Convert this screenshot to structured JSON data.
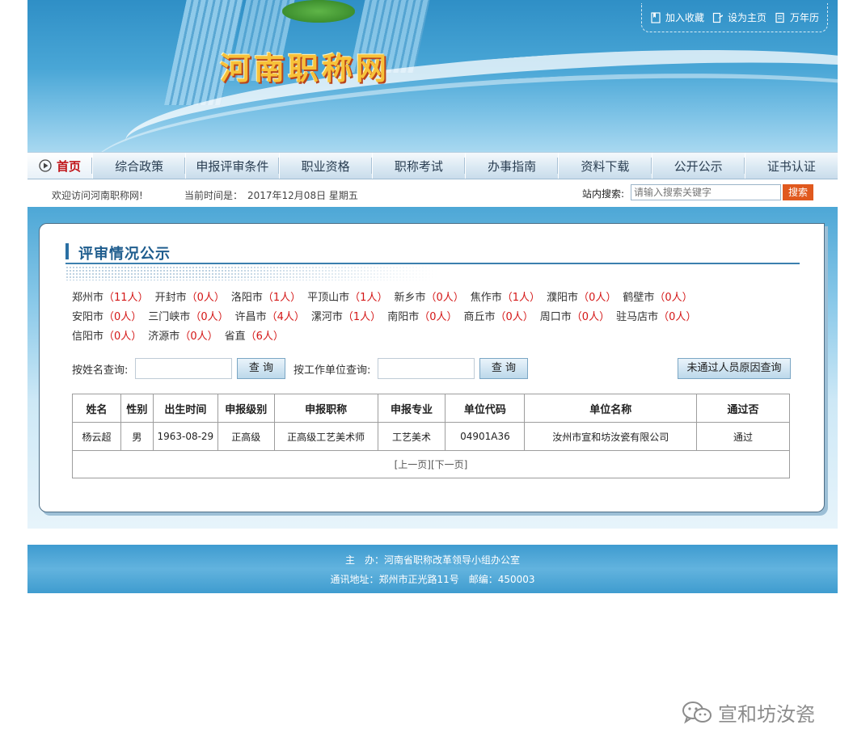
{
  "header": {
    "site_title": "河南职称网",
    "toplinks": [
      {
        "label": "加入收藏",
        "icon": "bookmark-icon"
      },
      {
        "label": "设为主页",
        "icon": "home-page-icon"
      },
      {
        "label": "万年历",
        "icon": "calendar-icon"
      }
    ]
  },
  "nav": {
    "home": "首页",
    "items": [
      "综合政策",
      "申报评审条件",
      "职业资格",
      "职称考试",
      "办事指南",
      "资料下载",
      "公开公示",
      "证书认证"
    ]
  },
  "infobar": {
    "welcome": "欢迎访问河南职称网!",
    "time_label": "当前时间是：",
    "time_value": "2017年12月08日 星期五",
    "search_label": "站内搜索:",
    "search_placeholder": "请输入搜索关键字",
    "search_button": "搜索"
  },
  "section": {
    "title": "评审情况公示",
    "cities": [
      {
        "name": "郑州市",
        "count": "（11人）"
      },
      {
        "name": "开封市",
        "count": "（0人）"
      },
      {
        "name": "洛阳市",
        "count": "（1人）"
      },
      {
        "name": "平顶山市",
        "count": "（1人）"
      },
      {
        "name": "新乡市",
        "count": "（0人）"
      },
      {
        "name": "焦作市",
        "count": "（1人）"
      },
      {
        "name": "濮阳市",
        "count": "（0人）"
      },
      {
        "name": "鹤壁市",
        "count": "（0人）"
      },
      {
        "name": "安阳市",
        "count": "（0人）"
      },
      {
        "name": "三门峡市",
        "count": "（0人）"
      },
      {
        "name": "许昌市",
        "count": "（4人）"
      },
      {
        "name": "漯河市",
        "count": "（1人）"
      },
      {
        "name": "南阳市",
        "count": "（0人）"
      },
      {
        "name": "商丘市",
        "count": "（0人）"
      },
      {
        "name": "周口市",
        "count": "（0人）"
      },
      {
        "name": "驻马店市",
        "count": "（0人）"
      },
      {
        "name": "信阳市",
        "count": "（0人）"
      },
      {
        "name": "济源市",
        "count": "（0人）"
      },
      {
        "name": "省直",
        "count": "（6人）"
      }
    ],
    "query": {
      "name_label": "按姓名查询:",
      "name_value": "",
      "name_button": "查 询",
      "unit_label": "按工作单位查询:",
      "unit_value": "",
      "unit_button": "查 询",
      "fail_button": "未通过人员原因查询"
    },
    "table": {
      "headers": [
        "姓名",
        "性别",
        "出生时间",
        "申报级别",
        "申报职称",
        "申报专业",
        "单位代码",
        "单位名称",
        "通过否"
      ],
      "rows": [
        [
          "杨云超",
          "男",
          "1963-08-29",
          "正高级",
          "正高级工艺美术师",
          "工艺美术",
          "04901A36",
          "汝州市宣和坊汝瓷有限公司",
          "通过"
        ]
      ],
      "pager_prev": "[上一页]",
      "pager_next": "[下一页]"
    }
  },
  "footer": {
    "line1": "主　办：河南省职称改革领导小组办公室",
    "line2": "通讯地址：郑州市正光路11号　邮编：450003"
  },
  "watermark": {
    "text": "宣和坊汝瓷",
    "icon": "wechat-icon"
  },
  "colors": {
    "nav_home": "#c0161a",
    "count_red": "#d41717",
    "search_button": "#e0591e",
    "title_blue": "#1f5d8e"
  }
}
